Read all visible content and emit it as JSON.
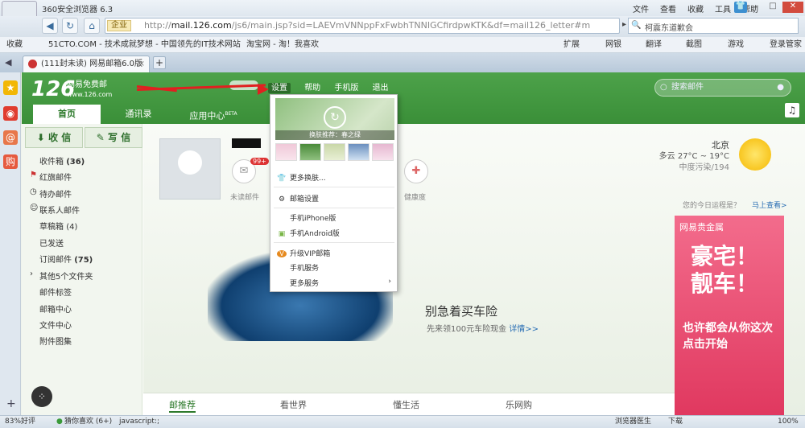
{
  "browser": {
    "title": "360安全浏览器 6.3",
    "menu": [
      "文件",
      "查看",
      "收藏",
      "工具",
      "帮助"
    ],
    "url_zone": "企业",
    "url_host": "mail.126.com",
    "url_prefix": "http://",
    "url_rest": "/js6/main.jsp?sid=LAEVmVNNppFxFwbhTNNIGCfirdpwKTK&df=mail126_letter#m",
    "search_text": "柯震东道歉会",
    "favorites": [
      "收藏",
      "51CTO.COM - 技术成就梦想 - 中国领先的IT技术网站",
      "淘宝网 - 淘！我喜欢"
    ],
    "fav_right": [
      "扩展",
      "网银",
      "翻译",
      "截图",
      "游戏",
      "登录管家"
    ],
    "tab_title": "(111封未读) 网易邮箱6.0版",
    "status_left": [
      "83%好评",
      "猜你喜欢 (6+)",
      "javascript:;"
    ],
    "status_right": [
      "浏览器医生",
      "下载",
      "100%"
    ]
  },
  "mail": {
    "logo": "126",
    "logo_name": "网易免费邮",
    "logo_url": "www.126.com",
    "header_links": [
      "设置",
      "帮助",
      "手机版",
      "退出"
    ],
    "search_placeholder": "搜索邮件",
    "nav_tabs": [
      "首页",
      "通讯录",
      "应用中心"
    ],
    "nav_beta": "BETA",
    "receive": "收 信",
    "compose": "写 信",
    "folders": [
      {
        "name": "收件箱",
        "count": "(36)"
      },
      {
        "name": "红旗邮件",
        "count": ""
      },
      {
        "name": "待办邮件",
        "count": ""
      },
      {
        "name": "联系人邮件",
        "count": ""
      },
      {
        "name": "草稿箱",
        "count": "(4)"
      },
      {
        "name": "已发送",
        "count": ""
      },
      {
        "name": "订阅邮件",
        "count": "(75)"
      },
      {
        "name": "其他5个文件夹",
        "count": ""
      },
      {
        "name": "邮件标签",
        "count": ""
      },
      {
        "name": "邮箱中心",
        "count": ""
      },
      {
        "name": "文件中心",
        "count": ""
      },
      {
        "name": "附件图集",
        "count": ""
      }
    ],
    "unread_label": "未读邮件",
    "unread_badge": "99+",
    "health_label": "健康度",
    "weather_city": "北京",
    "weather_desc": "多云 27°C ~ 19°C",
    "weather_aqi": "中度污染/194",
    "schedule_prompt": "您的今日运程是？",
    "schedule_link": "马上查看>",
    "ad_brand": "网易贵金属",
    "ad_big": "豪宅！靓车！",
    "ad_slogan": "也许都会从你这次点击开始",
    "promo_title": "别急着买车险",
    "promo_sub": "先来领100元车险现金",
    "promo_link": "详情>>",
    "bottom_tabs": [
      "邮推荐",
      "看世界",
      "懂生活",
      "乐网购"
    ]
  },
  "dropdown": {
    "skin_caption": "换肤推荐：春之绿",
    "items": [
      "更多换肤...",
      "邮箱设置",
      "手机iPhone版",
      "手机Android版",
      "升级VIP邮箱",
      "手机服务",
      "更多服务"
    ]
  }
}
